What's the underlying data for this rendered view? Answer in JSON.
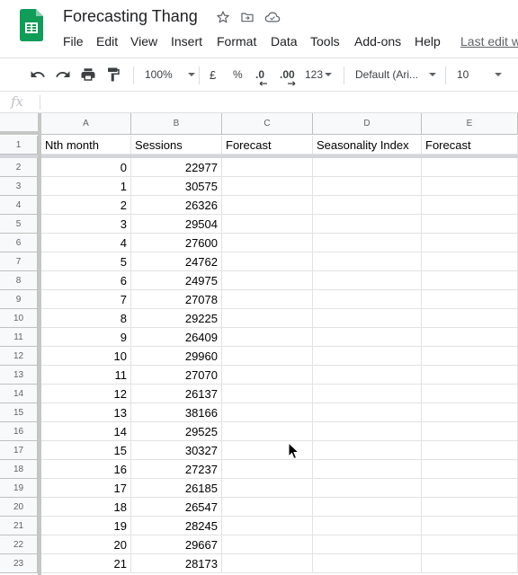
{
  "app": {
    "title": "Forecasting Thang",
    "menu": [
      "File",
      "Edit",
      "View",
      "Insert",
      "Format",
      "Data",
      "Tools",
      "Add-ons",
      "Help"
    ],
    "last_edit": "Last edit w"
  },
  "toolbar": {
    "zoom": "100%",
    "currency": "£",
    "percent": "%",
    "decrease_decimals": ".0",
    "increase_decimals": ".00",
    "more_formats": "123",
    "font": "Default (Ari...",
    "font_size": "10"
  },
  "formula_bar": {
    "fx_label": "fx",
    "value": ""
  },
  "sheet": {
    "columns": [
      "A",
      "B",
      "C",
      "D",
      "E"
    ],
    "header_row": {
      "number": "1",
      "cells": [
        "Nth month",
        "Sessions",
        "Forecast",
        "Seasonality Index",
        "Forecast"
      ]
    },
    "rows": [
      {
        "number": "2",
        "month": "0",
        "sessions": "22977"
      },
      {
        "number": "3",
        "month": "1",
        "sessions": "30575"
      },
      {
        "number": "4",
        "month": "2",
        "sessions": "26326"
      },
      {
        "number": "5",
        "month": "3",
        "sessions": "29504"
      },
      {
        "number": "6",
        "month": "4",
        "sessions": "27600"
      },
      {
        "number": "7",
        "month": "5",
        "sessions": "24762"
      },
      {
        "number": "8",
        "month": "6",
        "sessions": "24975"
      },
      {
        "number": "9",
        "month": "7",
        "sessions": "27078"
      },
      {
        "number": "10",
        "month": "8",
        "sessions": "29225"
      },
      {
        "number": "11",
        "month": "9",
        "sessions": "26409"
      },
      {
        "number": "12",
        "month": "10",
        "sessions": "29960"
      },
      {
        "number": "13",
        "month": "11",
        "sessions": "27070"
      },
      {
        "number": "14",
        "month": "12",
        "sessions": "26137"
      },
      {
        "number": "15",
        "month": "13",
        "sessions": "38166"
      },
      {
        "number": "16",
        "month": "14",
        "sessions": "29525"
      },
      {
        "number": "17",
        "month": "15",
        "sessions": "30327"
      },
      {
        "number": "18",
        "month": "16",
        "sessions": "27237"
      },
      {
        "number": "19",
        "month": "17",
        "sessions": "26185"
      },
      {
        "number": "20",
        "month": "18",
        "sessions": "26547"
      },
      {
        "number": "21",
        "month": "19",
        "sessions": "28245"
      },
      {
        "number": "22",
        "month": "20",
        "sessions": "29667"
      },
      {
        "number": "23",
        "month": "21",
        "sessions": "28173"
      }
    ]
  },
  "colors": {
    "sheets_green": "#0F9D58",
    "header_bg": "#f8f9fa",
    "gridline": "#e2e2e2"
  }
}
